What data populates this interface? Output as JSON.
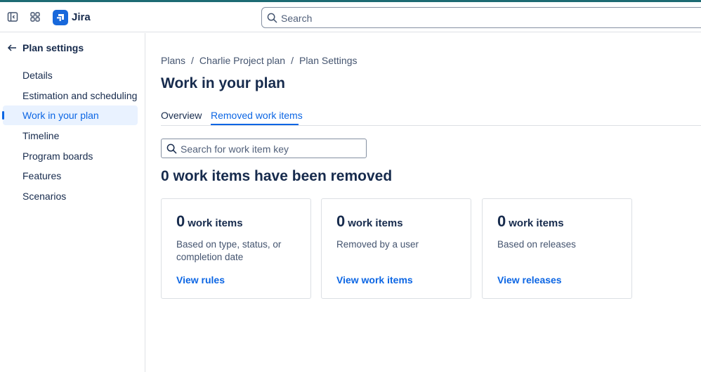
{
  "app": {
    "name": "Jira"
  },
  "topbar": {
    "search_placeholder": "Search",
    "icons": [
      "sidebar-toggle-icon",
      "app-switcher-icon",
      "jira-logo-icon",
      "search-icon"
    ]
  },
  "colors": {
    "accent": "#0c66e4",
    "brand": "#1868db",
    "top_strip": "#1d6b73",
    "active_nav_bg": "#e9f2ff"
  },
  "sidebar": {
    "back_label": "Plan settings",
    "items": [
      {
        "label": "Details",
        "active": false
      },
      {
        "label": "Estimation and scheduling",
        "active": false
      },
      {
        "label": "Work in your plan",
        "active": true
      },
      {
        "label": "Timeline",
        "active": false
      },
      {
        "label": "Program boards",
        "active": false
      },
      {
        "label": "Features",
        "active": false
      },
      {
        "label": "Scenarios",
        "active": false
      }
    ]
  },
  "breadcrumb": {
    "items": [
      "Plans",
      "Charlie Project plan",
      "Plan Settings"
    ],
    "separator": "/"
  },
  "main": {
    "title": "Work in your plan",
    "tabs": [
      {
        "label": "Overview",
        "active": false
      },
      {
        "label": "Removed work items",
        "active": true
      }
    ],
    "search_placeholder": "Search for work item key",
    "section_title": "0 work items have been removed",
    "cards": [
      {
        "count": "0",
        "unit": "work items",
        "description": "Based on type, status, or completion date",
        "link": "View rules"
      },
      {
        "count": "0",
        "unit": "work items",
        "description": "Removed by a user",
        "link": "View work items"
      },
      {
        "count": "0",
        "unit": "work items",
        "description": "Based on releases",
        "link": "View releases"
      }
    ]
  }
}
